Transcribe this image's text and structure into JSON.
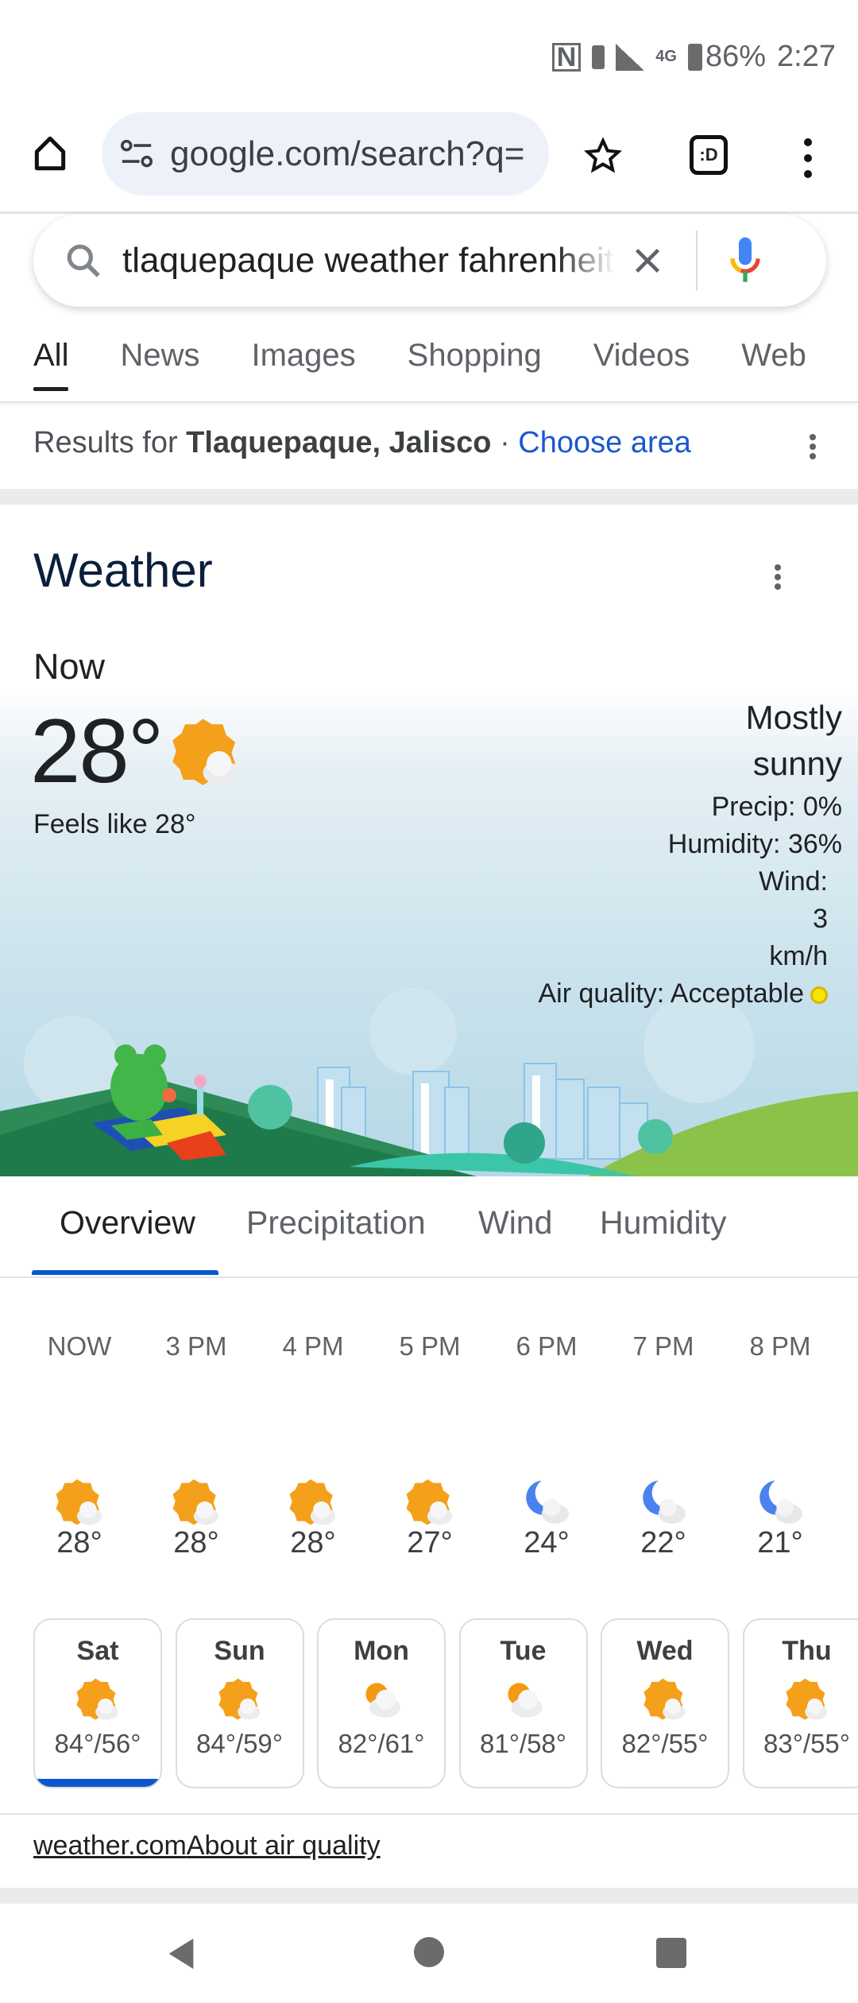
{
  "status_bar": {
    "battery": "86%",
    "time": "2:27",
    "network": "4G",
    "icons": [
      "nfc-icon",
      "vibrate-icon",
      "signal-icon",
      "battery-icon"
    ]
  },
  "browser": {
    "url": "google.com/search?q=",
    "icons": [
      "home-icon",
      "site-settings-icon",
      "star-icon",
      "tab-switcher-icon",
      "more-icon"
    ],
    "tab_switcher_label": ":D"
  },
  "search": {
    "query": "tlaquepaque weather fahrenheit"
  },
  "tabs": [
    "All",
    "News",
    "Images",
    "Shopping",
    "Videos",
    "Web"
  ],
  "results_for": {
    "prefix": "Results for ",
    "place": "Tlaquepaque, Jalisco",
    "sep": " · ",
    "link": "Choose area"
  },
  "weather": {
    "title": "Weather",
    "now_label": "Now",
    "temp": "28°",
    "current_icon": "sun-cloud-icon",
    "feels_like": "Feels like 28°",
    "condition_line1": "Mostly",
    "condition_line2": "sunny",
    "precip": "Precip: 0%",
    "humidity": "Humidity: 36%",
    "wind_label": "Wind:",
    "wind_value": "3",
    "wind_unit": "km/h",
    "air_quality": "Air quality: Acceptable",
    "air_quality_color": "#f5e600",
    "view_tabs": [
      "Overview",
      "Precipitation",
      "Wind",
      "Humidity"
    ],
    "active_view": "Overview",
    "hourly": [
      {
        "time": "NOW",
        "temp": "28°",
        "icon": "sun-cloud"
      },
      {
        "time": "3 PM",
        "temp": "28°",
        "icon": "sun-cloud"
      },
      {
        "time": "4 PM",
        "temp": "28°",
        "icon": "sun-cloud"
      },
      {
        "time": "5 PM",
        "temp": "27°",
        "icon": "sun-cloud"
      },
      {
        "time": "6 PM",
        "temp": "24°",
        "icon": "moon-cloud"
      },
      {
        "time": "7 PM",
        "temp": "22°",
        "icon": "moon-cloud"
      },
      {
        "time": "8 PM",
        "temp": "21°",
        "icon": "moon-cloud"
      }
    ],
    "daily": [
      {
        "day": "Sat",
        "temps": "84°/56°",
        "icon": "sun-cloud",
        "selected": true
      },
      {
        "day": "Sun",
        "temps": "84°/59°",
        "icon": "sun-cloud"
      },
      {
        "day": "Mon",
        "temps": "82°/61°",
        "icon": "cloud-sun"
      },
      {
        "day": "Tue",
        "temps": "81°/58°",
        "icon": "cloud-sun"
      },
      {
        "day": "Wed",
        "temps": "82°/55°",
        "icon": "sun-cloud"
      },
      {
        "day": "Thu",
        "temps": "83°/55°",
        "icon": "sun-cloud"
      }
    ],
    "source_link": "weather.com",
    "air_link": "About air quality",
    "accent": "#0b57d0"
  },
  "nav_bar": {
    "icons": [
      "back-icon",
      "home-circle-icon",
      "recents-icon"
    ]
  }
}
